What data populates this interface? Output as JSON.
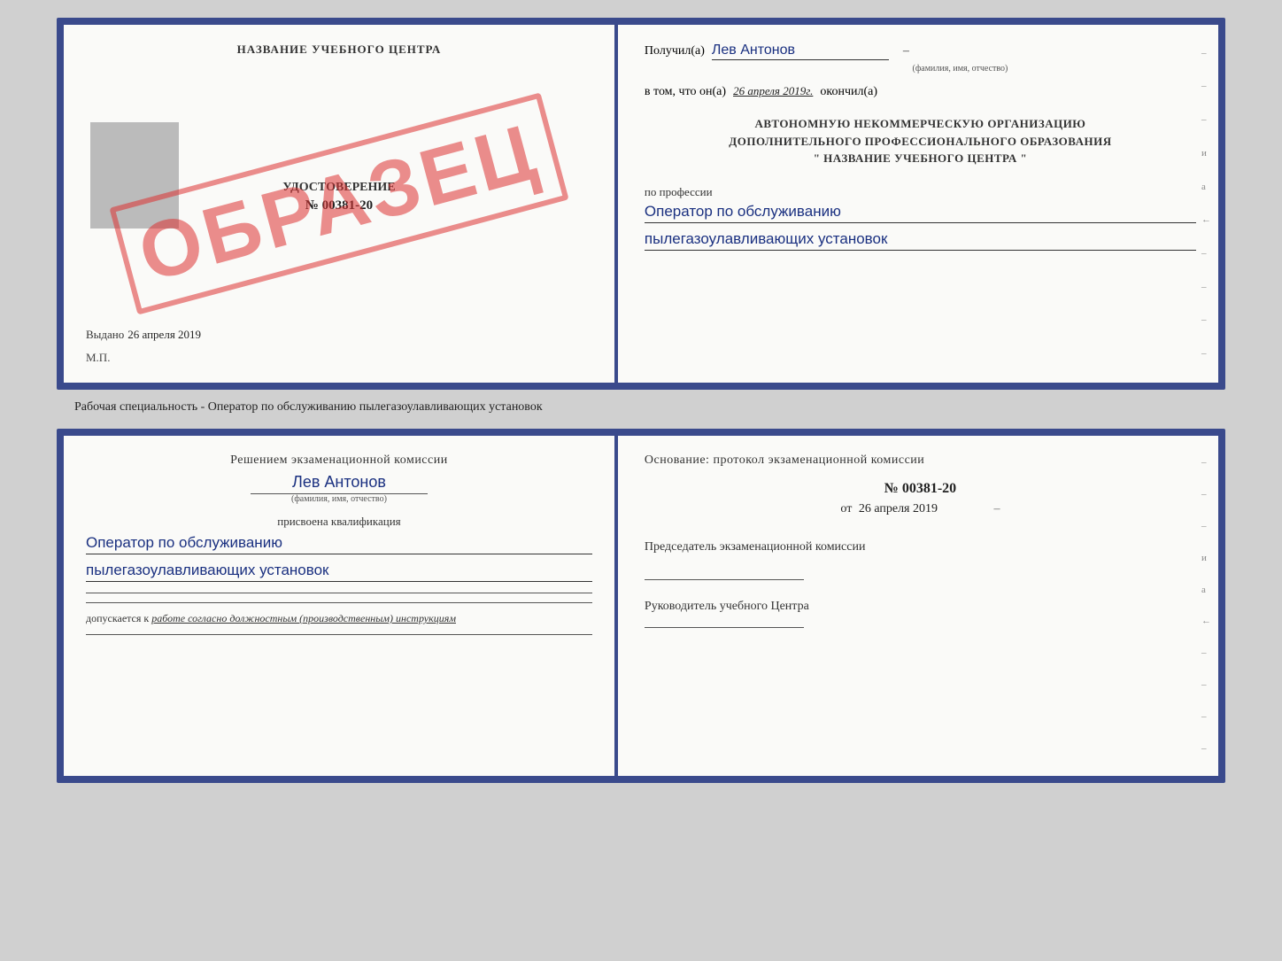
{
  "page": {
    "background_color": "#d0d0d0"
  },
  "top_certificate": {
    "left_page": {
      "title": "НАЗВАНИЕ УЧЕБНОГО ЦЕНТРА",
      "stamp": "ОБРАЗЕЦ",
      "doc_label": "УДОСТОВЕРЕНИЕ",
      "doc_number": "№ 00381-20",
      "issued_label": "Выдано",
      "issued_date": "26 апреля 2019",
      "mp_label": "М.П."
    },
    "right_page": {
      "received_prefix": "Получил(а)",
      "received_name": "Лев Антонов",
      "fio_label": "(фамилия, имя, отчество)",
      "date_prefix": "в том, что он(а)",
      "date_value": "26 апреля 2019г.",
      "date_suffix": "окончил(а)",
      "org_line1": "АВТОНОМНУЮ НЕКОММЕРЧЕСКУЮ ОРГАНИЗАЦИЮ",
      "org_line2": "ДОПОЛНИТЕЛЬНОГО ПРОФЕССИОНАЛЬНОГО ОБРАЗОВАНИЯ",
      "org_line3": "\" НАЗВАНИЕ УЧЕБНОГО ЦЕНТРА \"",
      "profession_label": "по профессии",
      "profession_line1": "Оператор по обслуживанию",
      "profession_line2": "пылегазоулавливающих установок"
    }
  },
  "specialty_label": "Рабочая специальность - Оператор по обслуживанию пылегазоулавливающих установок",
  "qualification_booklet": {
    "left_page": {
      "decision_label": "Решением экзаменационной комиссии",
      "person_name": "Лев Антонов",
      "fio_label": "(фамилия, имя, отчество)",
      "assigned_label": "присвоена квалификация",
      "profession_line1": "Оператор по обслуживанию",
      "profession_line2": "пылегазоулавливающих установок",
      "admission_prefix": "допускается к",
      "admission_value": "работе согласно должностным (производственным) инструкциям"
    },
    "right_page": {
      "basis_label": "Основание: протокол экзаменационной комиссии",
      "protocol_number": "№  00381-20",
      "date_prefix": "от",
      "date_value": "26 апреля 2019",
      "chairman_label": "Председатель экзаменационной комиссии",
      "director_label": "Руководитель учебного Центра"
    }
  },
  "side_marks": {
    "marks": [
      "–",
      "–",
      "–",
      "и",
      "а",
      "←",
      "–",
      "–",
      "–",
      "–"
    ]
  }
}
